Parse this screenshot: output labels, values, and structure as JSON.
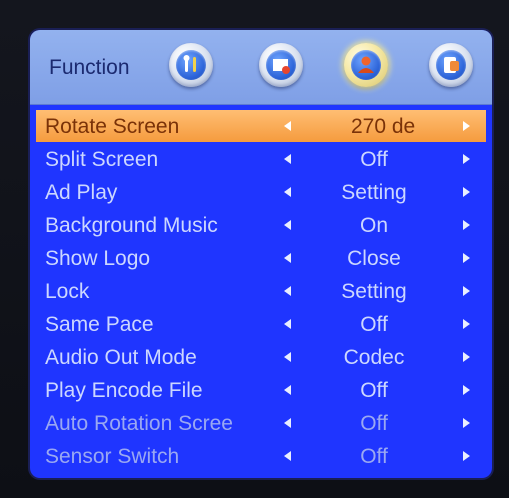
{
  "header": {
    "title": "Function",
    "icons": [
      {
        "name": "tools-icon"
      },
      {
        "name": "media-icon"
      },
      {
        "name": "user-icon"
      },
      {
        "name": "display-icon"
      }
    ]
  },
  "menu": {
    "items": [
      {
        "label": "Rotate Screen",
        "value": "270 de",
        "selected": true
      },
      {
        "label": "Split Screen",
        "value": "Off"
      },
      {
        "label": "Ad Play",
        "value": "Setting"
      },
      {
        "label": "Background Music",
        "value": "On"
      },
      {
        "label": "Show Logo",
        "value": "Close"
      },
      {
        "label": "Lock",
        "value": "Setting"
      },
      {
        "label": "Same Pace",
        "value": "Off"
      },
      {
        "label": "Audio Out Mode",
        "value": "Codec"
      },
      {
        "label": "Play Encode File",
        "value": "Off"
      },
      {
        "label": "Auto Rotation Scree",
        "value": "Off"
      },
      {
        "label": "Sensor Switch",
        "value": "Off"
      }
    ]
  },
  "colors": {
    "panel": "#1f35ff",
    "header": "#8aaaf0",
    "selected": "#f6a24a",
    "text": "#ccd7ff"
  }
}
